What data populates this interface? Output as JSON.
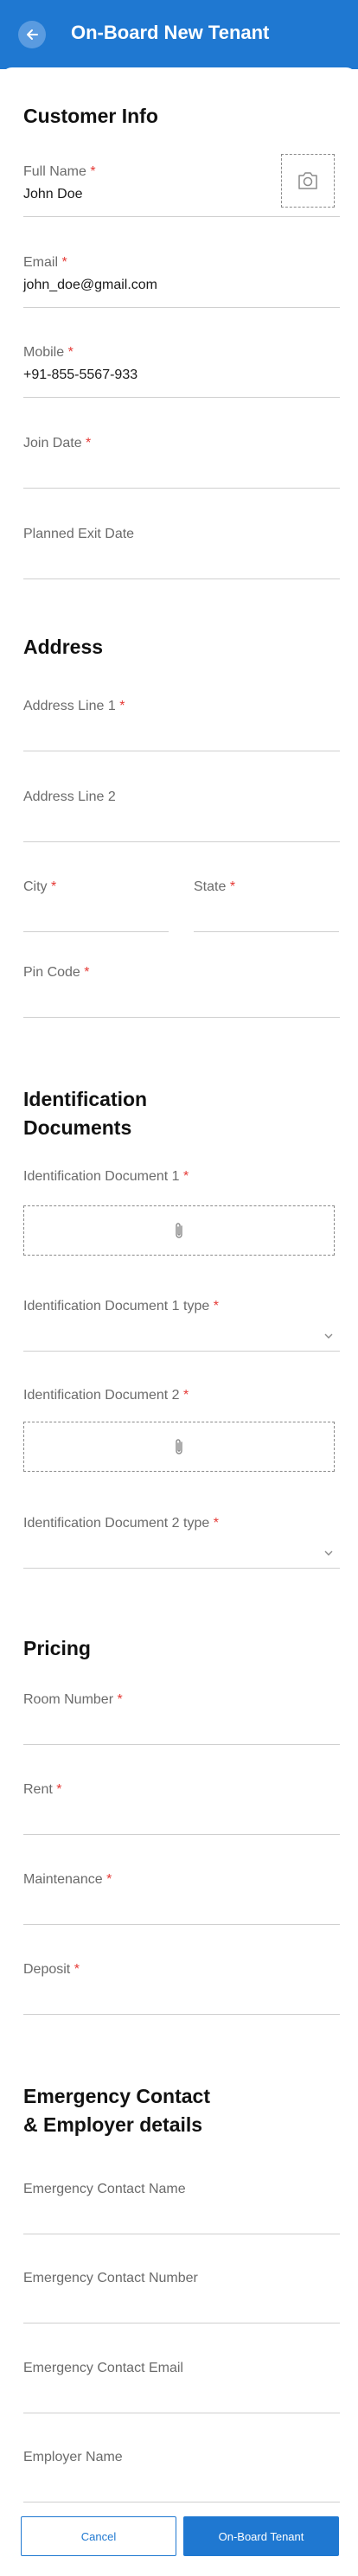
{
  "header": {
    "title": "On-Board New Tenant"
  },
  "customer": {
    "title": "Customer Info",
    "full_name_label": "Full Name",
    "full_name_value": "John Doe",
    "email_label": "Email",
    "email_value": "john_doe@gmail.com",
    "mobile_label": "Mobile",
    "mobile_value": "+91-855-5567-933",
    "join_date_label": "Join Date",
    "exit_date_label": "Planned Exit Date"
  },
  "address": {
    "title": "Address",
    "line1_label": "Address Line 1",
    "line2_label": "Address Line 2",
    "city_label": "City",
    "state_label": "State",
    "pin_label": "Pin Code"
  },
  "identification": {
    "title_line1": "Identification",
    "title_line2": "Documents",
    "doc1_label": "Identification Document 1",
    "doc1_type_label": "Identification Document 1 type",
    "doc2_label": "Identification Document 2",
    "doc2_type_label": "Identification Document 2 type"
  },
  "pricing": {
    "title": "Pricing",
    "room_label": "Room Number",
    "rent_label": "Rent",
    "maintenance_label": "Maintenance",
    "deposit_label": "Deposit"
  },
  "emergency": {
    "title_line1": "Emergency Contact",
    "title_line2": "& Employer details",
    "contact_name_label": "Emergency Contact Name",
    "contact_number_label": "Emergency Contact Number",
    "contact_email_label": "Emergency Contact Email",
    "employer_name_label": "Employer Name"
  },
  "footer": {
    "cancel_label": "Cancel",
    "submit_label": "On-Board Tenant"
  },
  "required_mark": "*",
  "colors": {
    "primary": "#1f78d1",
    "required": "#e53935"
  },
  "icons": [
    "back-arrow-icon",
    "camera-icon",
    "paperclip-icon",
    "chevron-down-icon"
  ]
}
